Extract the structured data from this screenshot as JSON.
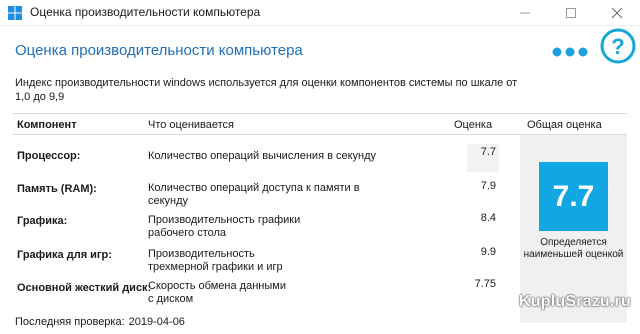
{
  "window": {
    "title": "Оценка производительности компьютера",
    "app_icon": "windows-logo-icon",
    "controls": [
      "minimize-icon",
      "maximize-icon",
      "close-icon"
    ]
  },
  "header": {
    "title": "Оценка производительности компьютера",
    "menu_icon": "more-dots-icon",
    "help_icon": "question-mark-icon"
  },
  "description": "Индекс производительности windows используется для оценки компонентов системы по шкале от 1,0 до 9,9",
  "table": {
    "columns": {
      "component": "Компонент",
      "what": "Что оценивается",
      "score": "Оценка",
      "overall": "Общая оценка"
    },
    "rows": [
      {
        "component": "Процессор:",
        "what": "Количество операций вычисления в секунду",
        "score": "7.7"
      },
      {
        "component": "Память (RAM):",
        "what": "Количество операций доступа к памяти в секунду",
        "score": "7.9"
      },
      {
        "component": "Графика:",
        "what": "Производительность графики рабочего стола",
        "score": "8.4"
      },
      {
        "component": "Графика для игр:",
        "what": "Производительность трехмерной графики и игр",
        "score": "9.9"
      },
      {
        "component": "Основной жесткий диск:",
        "what": "Скорость обмена данными с диском",
        "score": "7.75"
      }
    ]
  },
  "overall": {
    "score": "7.7",
    "caption": "Определяется наименьшей оценкой"
  },
  "footer": {
    "last_check_label": "Последняя проверка:",
    "last_check_date": "2019-04-06"
  },
  "watermark": {
    "text": "KupluSrazu.ru"
  },
  "colors": {
    "accent": "#1e6fb5",
    "score_tile": "#12a7e3",
    "help_circle": "#19a8d6"
  }
}
